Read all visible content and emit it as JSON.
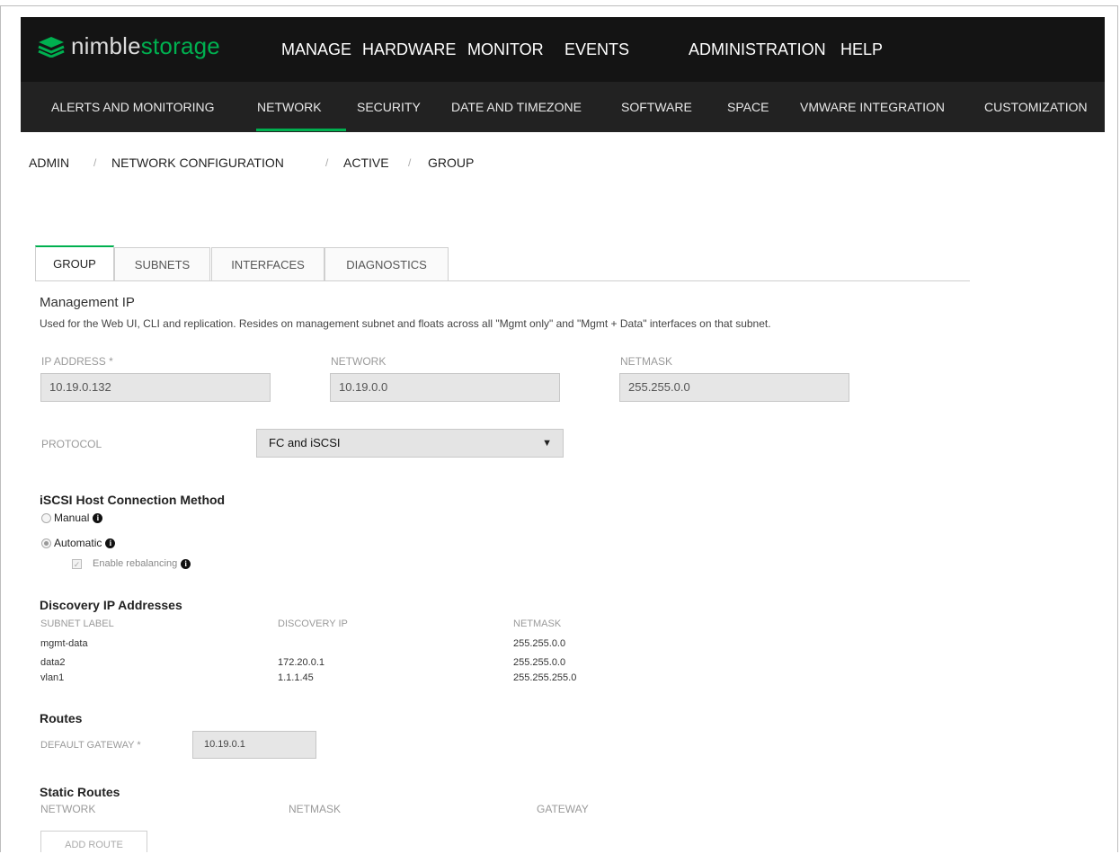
{
  "app": {
    "logo_left": "nimble",
    "logo_right": "storage"
  },
  "main_menu": [
    "MANAGE",
    "HARDWARE",
    "MONITOR",
    "EVENTS",
    "ADMINISTRATION",
    "HELP"
  ],
  "sub_menu": [
    "ALERTS AND MONITORING",
    "NETWORK",
    "SECURITY",
    "DATE AND TIMEZONE",
    "SOFTWARE",
    "SPACE",
    "VMWARE INTEGRATION",
    "CUSTOMIZATION"
  ],
  "breadcrumb": [
    "ADMIN",
    "NETWORK CONFIGURATION",
    "ACTIVE",
    "GROUP"
  ],
  "breadcrumb_sep": "/",
  "tabs": [
    "GROUP",
    "SUBNETS",
    "INTERFACES",
    "DIAGNOSTICS"
  ],
  "management_ip": {
    "title": "Management IP",
    "description": "Used for the Web UI, CLI and replication. Resides on management subnet and floats across all \"Mgmt only\" and \"Mgmt + Data\" interfaces on that subnet.",
    "ip_label": "IP ADDRESS *",
    "ip_value": "10.19.0.132",
    "network_label": "NETWORK",
    "network_value": "10.19.0.0",
    "netmask_label": "NETMASK",
    "netmask_value": "255.255.0.0"
  },
  "protocol": {
    "label": "PROTOCOL",
    "value": "FC and iSCSI",
    "arrow": "▼"
  },
  "iscsi": {
    "title": "iSCSI Host Connection Method",
    "manual": "Manual",
    "automatic": "Automatic",
    "rebalance": "Enable rebalancing",
    "info_glyph": "i",
    "check_glyph": "✓"
  },
  "discovery": {
    "title": "Discovery IP Addresses",
    "headers": [
      "SUBNET LABEL",
      "DISCOVERY IP",
      "NETMASK"
    ],
    "rows": [
      [
        "mgmt-data",
        "",
        "255.255.0.0"
      ],
      [
        "data2",
        "172.20.0.1",
        "255.255.0.0"
      ],
      [
        "vlan1",
        "1.1.1.45",
        "255.255.255.0"
      ]
    ]
  },
  "routes": {
    "title": "Routes",
    "gateway_label": "DEFAULT GATEWAY *",
    "gateway_value": "10.19.0.1"
  },
  "static_routes": {
    "title": "Static Routes",
    "headers": [
      "NETWORK",
      "NETMASK",
      "GATEWAY"
    ],
    "add_button": "ADD ROUTE"
  },
  "colors": {
    "accent": "#00b050",
    "topbar": "#141414",
    "subbar": "#222222"
  }
}
